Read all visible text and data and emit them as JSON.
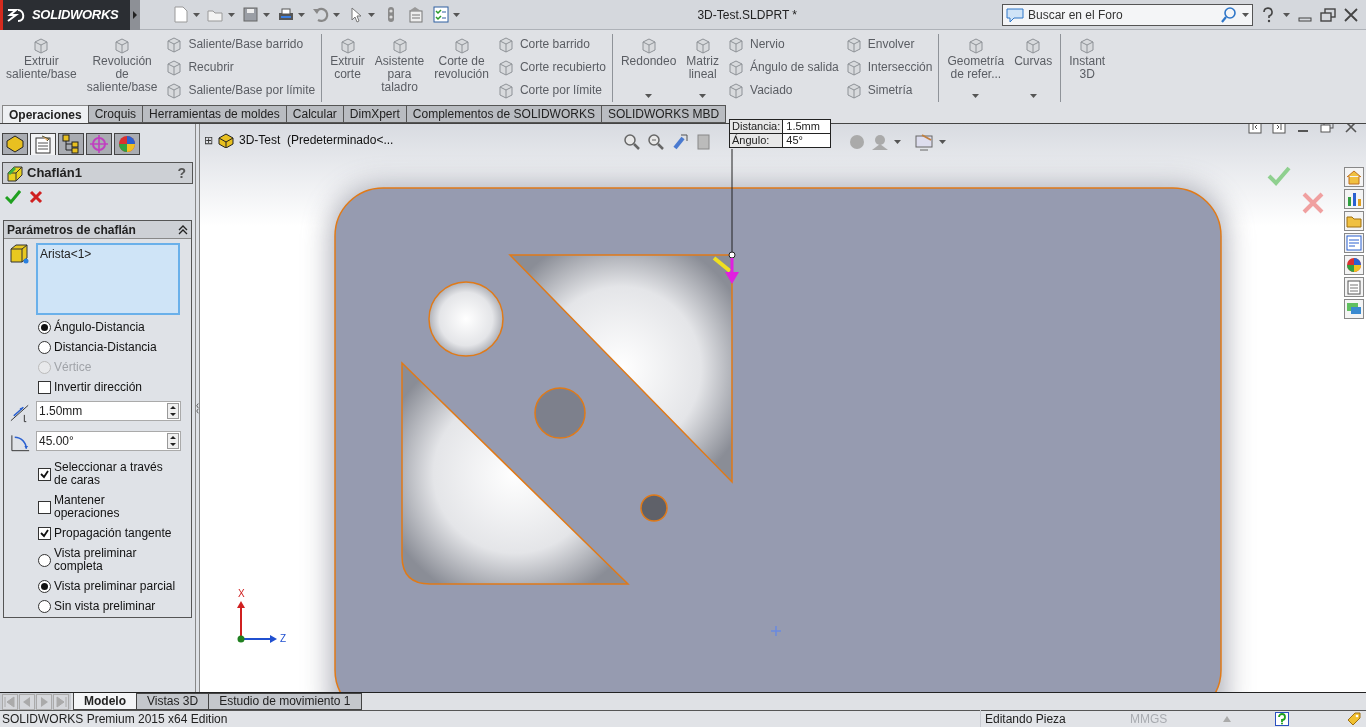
{
  "title_bar": {
    "app": "SOLIDWORKS",
    "title": "3D-Test.SLDPRT *",
    "search": {
      "placeholder": "Buscar en el Foro"
    }
  },
  "ribbon": {
    "groups": [
      {
        "columns": [
          {
            "kind": "large",
            "label": "Extruir\nsaliente/base",
            "dropdown": false
          },
          {
            "kind": "large",
            "label": "Revolución\nde\nsaliente/base",
            "dropdown": false
          },
          {
            "kind": "stack",
            "items": [
              "Saliente/Base barrido",
              "Recubrir",
              "Saliente/Base por límite"
            ]
          }
        ]
      },
      {
        "columns": [
          {
            "kind": "large",
            "label": "Extruir\ncorte",
            "dropdown": false
          },
          {
            "kind": "large",
            "label": "Asistente\npara\ntaladro",
            "dropdown": false
          },
          {
            "kind": "large",
            "label": "Corte de\nrevolución",
            "dropdown": false
          },
          {
            "kind": "stack",
            "items": [
              "Corte barrido",
              "Corte recubierto",
              "Corte por límite"
            ]
          }
        ]
      },
      {
        "columns": [
          {
            "kind": "large",
            "label": "Redondeo",
            "dropdown": true
          },
          {
            "kind": "large",
            "label": "Matriz\nlineal",
            "dropdown": true
          },
          {
            "kind": "stack",
            "items": [
              "Nervio",
              "Ángulo de salida",
              "Vaciado"
            ]
          },
          {
            "kind": "stack",
            "items": [
              "Envolver",
              "Intersección",
              "Simetría"
            ]
          }
        ]
      },
      {
        "columns": [
          {
            "kind": "large",
            "label": "Geometría\nde refer...",
            "dropdown": true
          },
          {
            "kind": "large",
            "label": "Curvas",
            "dropdown": true
          }
        ]
      },
      {
        "columns": [
          {
            "kind": "large",
            "label": "Instant\n3D",
            "dropdown": false
          }
        ]
      }
    ]
  },
  "tabs": [
    {
      "label": "Operaciones",
      "selected": true
    },
    {
      "label": "Croquis",
      "selected": false
    },
    {
      "label": "Herramientas de moldes",
      "selected": false
    },
    {
      "label": "Calcular",
      "selected": false
    },
    {
      "label": "DimXpert",
      "selected": false
    },
    {
      "label": "Complementos de SOLIDWORKS",
      "selected": false
    },
    {
      "label": "SOLIDWORKS MBD",
      "selected": false
    }
  ],
  "property_manager": {
    "panel_tabs": [
      {
        "selected": false
      },
      {
        "selected": true
      },
      {
        "selected": false
      },
      {
        "selected": false
      },
      {
        "selected": false
      }
    ],
    "title": "Chaflán1",
    "help": "?",
    "group_title": "Parámetros de chaflán",
    "selection": "Arista<1>",
    "controls": [
      {
        "kind": "radio",
        "label": "Ángulo-Distancia",
        "checked": true,
        "disabled": false
      },
      {
        "kind": "radio",
        "label": "Distancia-Distancia",
        "checked": false,
        "disabled": false
      },
      {
        "kind": "radio",
        "label": "Vértice",
        "checked": false,
        "disabled": true
      },
      {
        "kind": "checkbox",
        "label": "Invertir dirección",
        "checked": false,
        "disabled": false
      },
      {
        "kind": "distance",
        "value": "1.50mm"
      },
      {
        "kind": "angle",
        "value": "45.00°"
      },
      {
        "kind": "checkbox",
        "label": "Seleccionar a través\nde caras",
        "checked": true,
        "disabled": false
      },
      {
        "kind": "checkbox",
        "label": "Mantener\noperaciones",
        "checked": false,
        "disabled": false
      },
      {
        "kind": "checkbox",
        "label": "Propagación tangente",
        "checked": true,
        "disabled": false
      },
      {
        "kind": "radio",
        "label": "Vista preliminar\ncompleta",
        "checked": false,
        "disabled": false
      },
      {
        "kind": "radio",
        "label": "Vista preliminar parcial",
        "checked": true,
        "disabled": false
      },
      {
        "kind": "radio",
        "label": "Sin vista preliminar",
        "checked": false,
        "disabled": false
      }
    ]
  },
  "viewport": {
    "tree_expander": "⊞",
    "tree_root": "3D-Test  (Predeterminado<...",
    "tooltip": [
      {
        "label": "Distancia:",
        "value": "1.5mm"
      },
      {
        "label": "Ángulo:",
        "value": "45°"
      }
    ],
    "triad": [
      "X",
      "Z"
    ]
  },
  "bottom_tabs": [
    {
      "label": "Modelo",
      "selected": true
    },
    {
      "label": "Vistas 3D",
      "selected": false
    },
    {
      "label": "Estudio de movimiento 1",
      "selected": false
    }
  ],
  "status_bar": {
    "edition": "SOLIDWORKS Premium 2015 x64 Edition",
    "mode": "Editando Pieza",
    "units": "MMGS"
  }
}
